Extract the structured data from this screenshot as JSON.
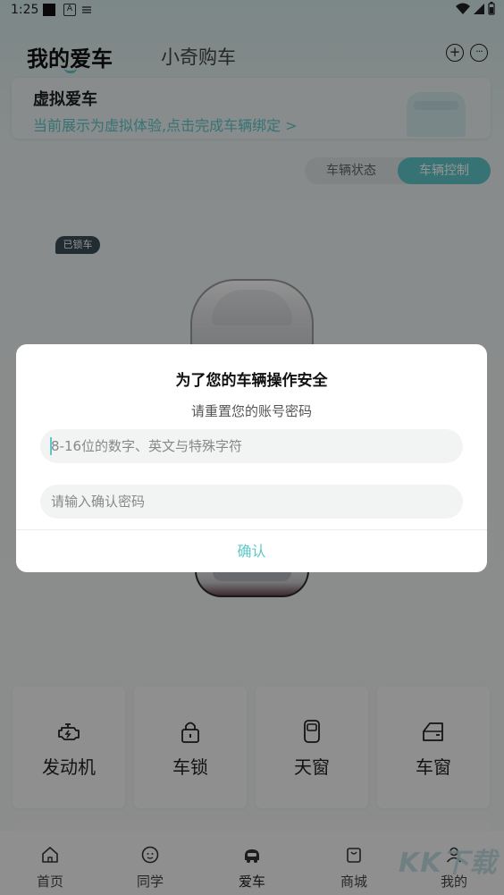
{
  "status_bar": {
    "time": "1:25",
    "app_letter": "A"
  },
  "header": {
    "tab_my_car": "我的爱车",
    "tab_buy_car": "小奇购车"
  },
  "virtual_card": {
    "title": "虚拟爱车",
    "link": "当前展示为虚拟体验,点击完成车辆绑定 >"
  },
  "segmented": {
    "status": "车辆状态",
    "control": "车辆控制"
  },
  "lock_badge": "已锁车",
  "controls": [
    {
      "label": "发动机",
      "icon": "engine-icon"
    },
    {
      "label": "车锁",
      "icon": "lock-icon"
    },
    {
      "label": "天窗",
      "icon": "sunroof-icon"
    },
    {
      "label": "车窗",
      "icon": "window-icon"
    }
  ],
  "bottom_nav": [
    {
      "label": "首页",
      "icon": "home-icon"
    },
    {
      "label": "同学",
      "icon": "classmates-icon"
    },
    {
      "label": "爱车",
      "icon": "car-icon"
    },
    {
      "label": "商城",
      "icon": "shopping-bag-icon"
    },
    {
      "label": "我的",
      "icon": "profile-icon"
    }
  ],
  "dialog": {
    "title": "为了您的车辆操作安全",
    "subtitle": "请重置您的账号密码",
    "new_password_placeholder": "8-16位的数字、英文与特殊字符",
    "confirm_password_placeholder": "请输入确认密码",
    "confirm_button": "确认"
  },
  "watermark": "KK下载",
  "colors": {
    "accent": "#5fc7c8",
    "overlay": "rgba(0,0,0,0.42)",
    "badge": "#3a4e58"
  }
}
